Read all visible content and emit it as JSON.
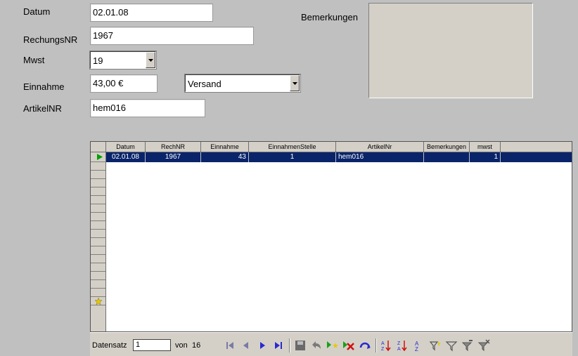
{
  "form": {
    "datum_label": "Datum",
    "datum_value": "02.01.08",
    "rechnungsnr_label": "RechungsNR",
    "rechnungsnr_value": "1967",
    "mwst_label": "Mwst",
    "mwst_value": "19",
    "einnahme_label": "Einnahme",
    "einnahme_value": "43,00 €",
    "einnahme_type_value": "Versand",
    "artikelnr_label": "ArtikelNR",
    "artikelnr_value": "hem016",
    "bemerkungen_label": "Bemerkungen"
  },
  "grid": {
    "columns": [
      "Datum",
      "RechNR",
      "Einnahme",
      "EinnahmenStelle",
      "ArtikelNr",
      "Bemerkungen",
      "mwst"
    ],
    "rows": [
      [
        "02.01.08",
        "1967",
        "43",
        "1",
        "hem016",
        "",
        "1"
      ]
    ]
  },
  "navbar": {
    "record_label": "Datensatz",
    "record_value": "1",
    "of_label": "von",
    "total": "16"
  },
  "colors": {
    "selection": "#0a246a",
    "background": "#c0c0c0"
  }
}
